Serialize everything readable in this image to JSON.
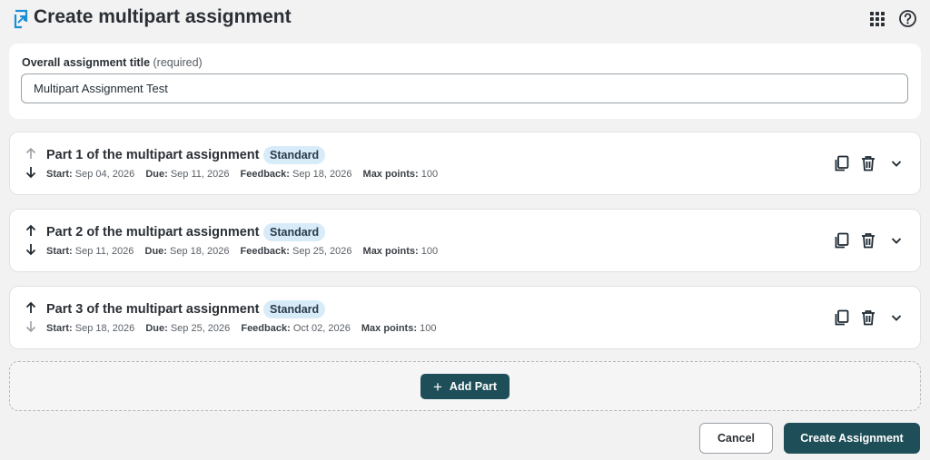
{
  "header": {
    "title": "Create multipart assignment",
    "logo_icon": "assignment-icon",
    "apps_icon": "grid-apps-icon",
    "help_icon": "help-circle-icon",
    "accent_color": "#1b8fd6"
  },
  "title_section": {
    "label": "Overall assignment title",
    "required_text": "(required)",
    "value": "Multipart Assignment Test"
  },
  "parts": [
    {
      "title": "Part 1 of the multipart assignment",
      "badge": "Standard",
      "start_label": "Start:",
      "start": "Sep 04, 2026",
      "due_label": "Due:",
      "due": "Sep 11, 2026",
      "feedback_label": "Feedback:",
      "feedback": "Sep 18, 2026",
      "points_label": "Max points:",
      "points": "100",
      "move_up_enabled": false,
      "move_down_enabled": true
    },
    {
      "title": "Part 2 of the multipart assignment",
      "badge": "Standard",
      "start_label": "Start:",
      "start": "Sep 11, 2026",
      "due_label": "Due:",
      "due": "Sep 18, 2026",
      "feedback_label": "Feedback:",
      "feedback": "Sep 25, 2026",
      "points_label": "Max points:",
      "points": "100",
      "move_up_enabled": true,
      "move_down_enabled": true
    },
    {
      "title": "Part 3 of the multipart assignment",
      "badge": "Standard",
      "start_label": "Start:",
      "start": "Sep 18, 2026",
      "due_label": "Due:",
      "due": "Sep 25, 2026",
      "feedback_label": "Feedback:",
      "feedback": "Oct 02, 2026",
      "points_label": "Max points:",
      "points": "100",
      "move_up_enabled": true,
      "move_down_enabled": false
    }
  ],
  "part_actions": {
    "copy_icon": "copy-icon",
    "delete_icon": "trash-icon",
    "expand_icon": "chevron-down-icon"
  },
  "add_part": {
    "label": "Add Part",
    "icon": "plus-icon"
  },
  "footer": {
    "cancel_label": "Cancel",
    "create_label": "Create Assignment"
  },
  "colors": {
    "primary_button": "#1e4e58",
    "badge_bg": "#d7ebf9",
    "page_bg": "#f2f2f2"
  }
}
